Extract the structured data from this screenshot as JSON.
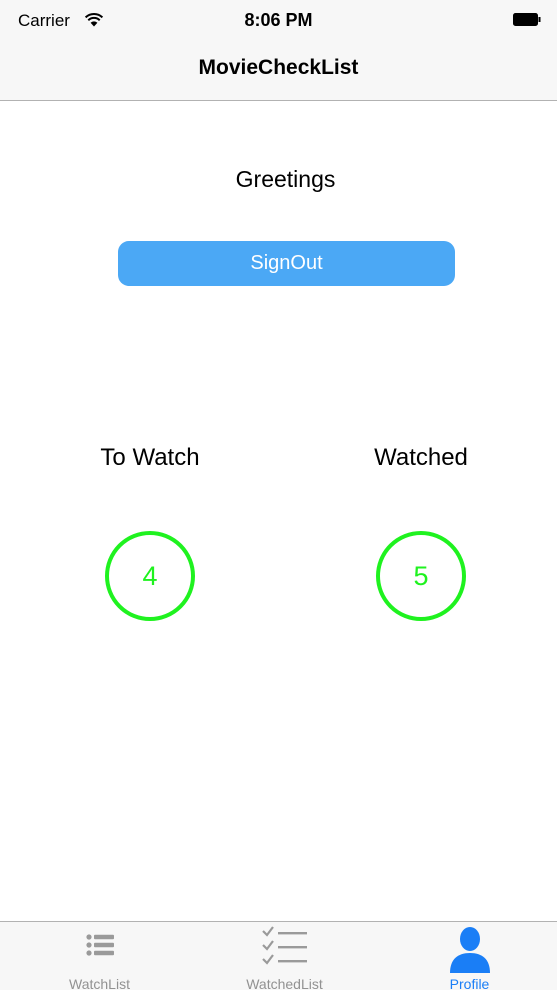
{
  "status_bar": {
    "carrier": "Carrier",
    "time": "8:06 PM",
    "wifi_icon": "wifi-icon",
    "battery_icon": "battery-icon"
  },
  "nav": {
    "title": "MovieCheckList"
  },
  "profile": {
    "greeting": "Greetings",
    "signout_label": "SignOut",
    "to_watch_label": "To Watch",
    "to_watch_count": "4",
    "watched_label": "Watched",
    "watched_count": "5"
  },
  "tab_bar": {
    "items": [
      {
        "label": "WatchList",
        "icon": "list-icon",
        "selected": false
      },
      {
        "label": "WatchedList",
        "icon": "checklist-icon",
        "selected": false
      },
      {
        "label": "Profile",
        "icon": "person-icon",
        "selected": true
      }
    ]
  },
  "colors": {
    "accent": "#1a7ef6",
    "button": "#4ba8f5",
    "count": "#1ff21f",
    "tab_inactive": "#929292"
  }
}
